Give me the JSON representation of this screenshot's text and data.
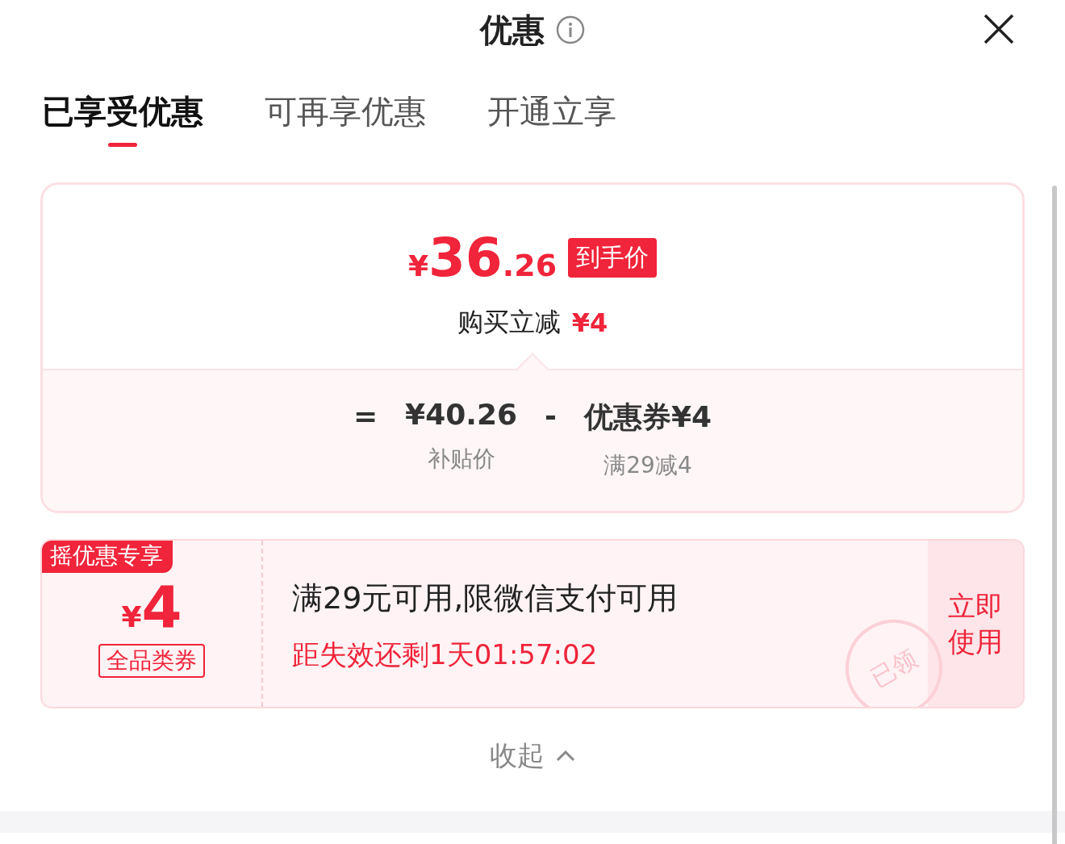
{
  "header": {
    "title": "优惠"
  },
  "tabs": [
    {
      "label": "已享受优惠",
      "selected": true
    },
    {
      "label": "可再享优惠",
      "selected": false
    },
    {
      "label": "开通立享",
      "selected": false
    }
  ],
  "summary": {
    "currency": "¥",
    "price_int": "36",
    "price_dec": ".26",
    "badge": "到手价",
    "discount_label": "购买立减",
    "discount_value": "¥4",
    "breakdown": [
      {
        "kind": "operator",
        "text": "="
      },
      {
        "kind": "item",
        "value": "¥40.26",
        "label": "补贴价"
      },
      {
        "kind": "operator",
        "text": "-"
      },
      {
        "kind": "item",
        "value": "优惠券¥4",
        "label": "满29减4"
      }
    ]
  },
  "coupon": {
    "tag": "摇优惠专享",
    "currency": "¥",
    "amount": "4",
    "category": "全品类券",
    "condition": "满29元可用,限微信支付可用",
    "countdown": "距失效还剩1天01:57:02",
    "stamp": "已领",
    "action": "立即使用"
  },
  "collapse": {
    "label": "收起"
  }
}
